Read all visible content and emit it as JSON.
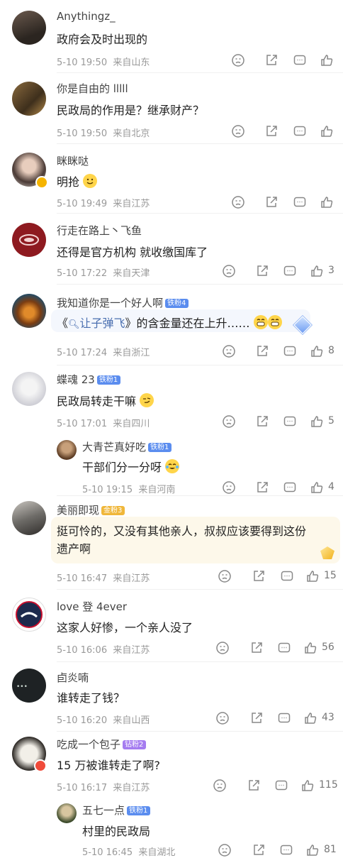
{
  "comments": [
    {
      "user": "Anythingz_",
      "text": "政府会及时出现的",
      "date": "5-10 19:50",
      "loc": "来自山东",
      "likes": ""
    },
    {
      "user": "你是自由的 lllll",
      "text": "民政局的作用是？继承财产？",
      "date": "5-10 19:50",
      "loc": "来自北京",
      "likes": ""
    },
    {
      "user": "眯眯哒",
      "text": "明抢",
      "date": "5-10 19:49",
      "loc": "来自江苏",
      "likes": ""
    },
    {
      "user": "行走在路上丶飞鱼",
      "text": "还得是官方机构 就收缴国库了",
      "date": "5-10 17:22",
      "loc": "来自天津",
      "likes": "3"
    },
    {
      "user": "我知道你是一个好人啊",
      "badge": "铁粉4",
      "text_pre": "《",
      "text_link": "让子弹飞",
      "text_post": "》的含金量还在上升……",
      "date": "5-10 17:24",
      "loc": "来自浙江",
      "likes": "8"
    },
    {
      "user": "蝶魂 23",
      "badge": "铁粉1",
      "text": "民政局转走干嘛",
      "date": "5-10 17:01",
      "loc": "来自四川",
      "likes": "5"
    },
    {
      "user": "大青芒真好吃",
      "badge": "铁粉1",
      "text": "干部们分一分呀",
      "date": "5-10 19:15",
      "loc": "来自河南",
      "likes": "4"
    },
    {
      "user": "美丽即现",
      "badge": "金粉3",
      "text_line1": "挺可怜的，又没有其他亲人，叔叔应该要得到这份",
      "text_line2": "遗产啊",
      "date": "5-10 16:47",
      "loc": "来自江苏",
      "likes": "15"
    },
    {
      "user": "love 登 4ever",
      "text": "这家人好惨，一个亲人没了",
      "date": "5-10 16:06",
      "loc": "来自江苏",
      "likes": "56"
    },
    {
      "user": "卣炎喃",
      "text": "谁转走了钱？",
      "date": "5-10 16:20",
      "loc": "来自山西",
      "likes": "43"
    },
    {
      "user": "吃成一个包子",
      "badge": "钻粉2",
      "text": "15 万被谁转走了啊?",
      "date": "5-10 16:17",
      "loc": "来自江苏",
      "likes": "115"
    },
    {
      "user": "五七一点",
      "badge": "铁粉1",
      "text": "村里的民政局",
      "date": "5-10 16:45",
      "loc": "来自湖北",
      "likes": "81"
    }
  ],
  "icons": {
    "emoji": "emoji-reaction-icon",
    "share": "share-icon",
    "reply": "reply-icon",
    "like": "like-icon"
  },
  "colors": {
    "meta": "#999999",
    "badge_tie": "#5b8def",
    "badge_jin": "#f0b73a",
    "badge_zuan": "#a57cf0"
  }
}
